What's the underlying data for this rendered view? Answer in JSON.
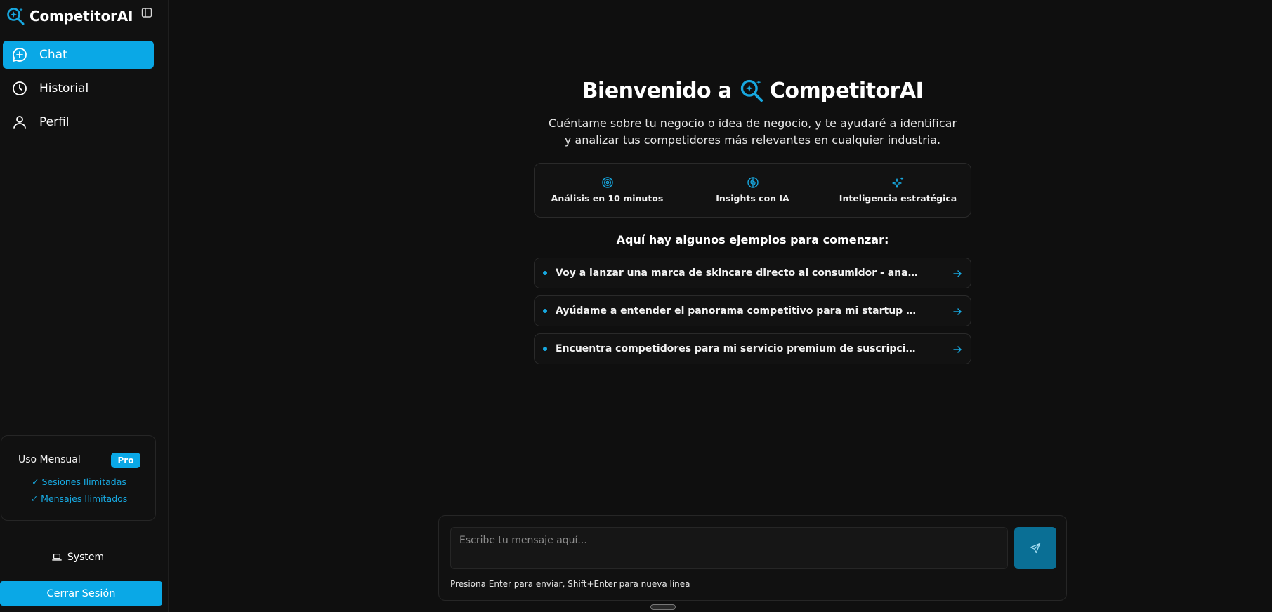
{
  "app": {
    "name": "CompetitorAI"
  },
  "colors": {
    "accent": "#0aa8e6",
    "accent_dark": "#0a6f95",
    "background": "#0f0f0f",
    "sidebar": "#111111"
  },
  "sidebar": {
    "items": [
      {
        "label": "Chat",
        "icon": "chat-plus-icon",
        "active": true
      },
      {
        "label": "Historial",
        "icon": "clock-icon",
        "active": false
      },
      {
        "label": "Perfil",
        "icon": "user-icon",
        "active": false
      }
    ],
    "usage": {
      "title": "Uso Mensual",
      "badge": "Pro",
      "lines": [
        "✓ Sesiones Ilimitadas",
        "✓ Mensajes Ilimitados"
      ]
    },
    "theme_label": "System",
    "logout_label": "Cerrar Sesión"
  },
  "main": {
    "welcome_prefix": "Bienvenido a",
    "welcome_brand": "CompetitorAI",
    "intro_line1": "Cuéntame sobre tu negocio o idea de negocio, y te ayudaré a identificar",
    "intro_line2": "y analizar tus competidores más relevantes en cualquier industria.",
    "features": [
      {
        "label": "Análisis en 10 minutos",
        "icon": "target-icon"
      },
      {
        "label": "Insights con IA",
        "icon": "brain-icon"
      },
      {
        "label": "Inteligencia estratégica",
        "icon": "sparkles-icon"
      }
    ],
    "examples_title": "Aquí hay algunos ejemplos para comenzar:",
    "examples": [
      "Voy a lanzar una marca de skincare directo al consumidor - analiza mi...",
      "Ayúdame a entender el panorama competitivo para mi startup fintech",
      "Encuentra competidores para mi servicio premium de suscripción de café"
    ]
  },
  "composer": {
    "placeholder": "Escribe tu mensaje aquí...",
    "hint": "Presiona Enter para enviar, Shift+Enter para nueva línea"
  }
}
